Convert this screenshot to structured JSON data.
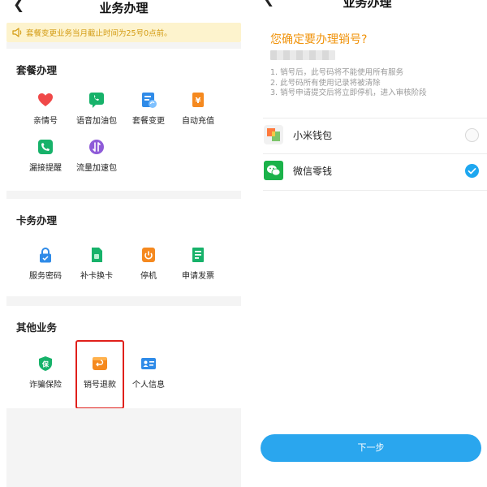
{
  "left": {
    "header": {
      "title": "业务办理"
    },
    "notice": {
      "text": "套餐变更业务当月截止时间为25号0点前。"
    },
    "sections": [
      {
        "title": "套餐办理",
        "items": [
          {
            "label": "亲情号",
            "icon": "heart-icon",
            "color": "#f04848"
          },
          {
            "label": "语音加油包",
            "icon": "phone-chat-icon",
            "color": "#17b26a"
          },
          {
            "label": "套餐变更",
            "icon": "plan-change-icon",
            "color": "#2f8be8"
          },
          {
            "label": "自动充值",
            "icon": "recharge-icon",
            "color": "#f5891f"
          },
          {
            "label": "漏接提醒",
            "icon": "missed-call-icon",
            "color": "#17b26a"
          },
          {
            "label": "流量加速包",
            "icon": "data-speed-icon",
            "color": "#8e5bd8"
          }
        ]
      },
      {
        "title": "卡务办理",
        "items": [
          {
            "label": "服务密码",
            "icon": "lock-icon",
            "color": "#2f8be8"
          },
          {
            "label": "补卡换卡",
            "icon": "sim-card-icon",
            "color": "#17b26a"
          },
          {
            "label": "停机",
            "icon": "power-icon",
            "color": "#f5891f"
          },
          {
            "label": "申请发票",
            "icon": "invoice-icon",
            "color": "#17b26a"
          }
        ]
      },
      {
        "title": "其他业务",
        "items": [
          {
            "label": "诈骗保险",
            "icon": "shield-icon",
            "color": "#17b26a"
          },
          {
            "label": "销号退款",
            "icon": "refund-icon",
            "color": "#f5891f"
          },
          {
            "label": "个人信息",
            "icon": "id-card-icon",
            "color": "#2f8be8"
          }
        ]
      }
    ]
  },
  "right": {
    "header": {
      "title": "业务办理"
    },
    "question": "您确定要办理销号?",
    "notes": [
      "1. 销号后，此号码将不能使用所有服务",
      "2. 此号码所有使用记录将被清除",
      "3. 销号申请提交后将立即停机，进入审核阶段"
    ],
    "payments": [
      {
        "label": "小米钱包",
        "icon": "mi-wallet-icon",
        "selected": false
      },
      {
        "label": "微信零钱",
        "icon": "wechat-icon",
        "selected": true
      }
    ],
    "next_label": "下一步"
  },
  "colors": {
    "accent": "#2aa6ee",
    "warning": "#f0930b",
    "highlight": "#e0201b"
  }
}
